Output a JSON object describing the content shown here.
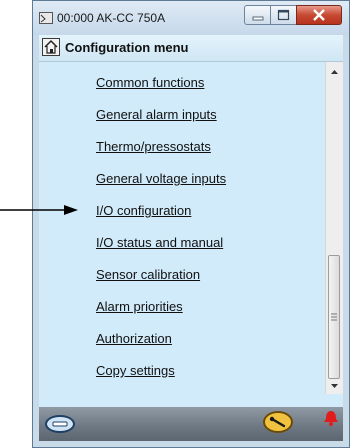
{
  "window": {
    "title": "00:000 AK-CC 750A"
  },
  "header": {
    "title": "Configuration menu"
  },
  "menu": {
    "items": [
      {
        "label": "Common functions"
      },
      {
        "label": "General alarm inputs"
      },
      {
        "label": "Thermo/pressostats"
      },
      {
        "label": "General voltage inputs"
      },
      {
        "label": "I/O configuration"
      },
      {
        "label": "I/O status and manual"
      },
      {
        "label": "Sensor calibration"
      },
      {
        "label": "Alarm priorities"
      },
      {
        "label": "Authorization"
      },
      {
        "label": "Copy settings"
      }
    ]
  },
  "icons": {
    "app": "device-icon",
    "home": "home-icon",
    "minimize": "minimize-icon",
    "maximize": "maximize-icon",
    "close": "close-icon",
    "left_status": "link-icon",
    "right_status": "tool-icon",
    "alarm": "alarm-bell-icon"
  },
  "colors": {
    "client_bg": "#d1ebfa",
    "close_button": "#c74a33",
    "alarm": "#e21b1b",
    "tool_button": "#f0c23f"
  }
}
